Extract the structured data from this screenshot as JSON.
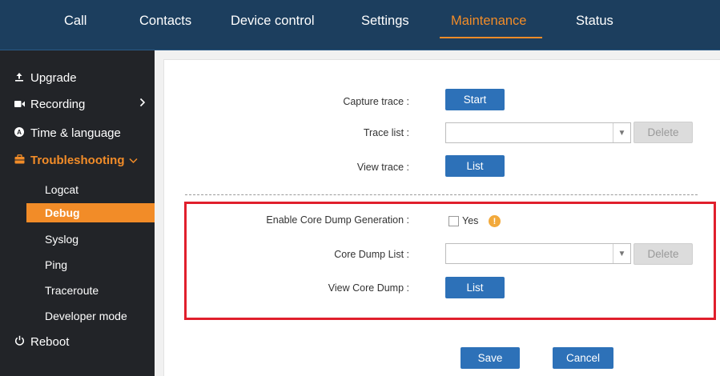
{
  "nav": {
    "tabs": [
      {
        "label": "Call"
      },
      {
        "label": "Contacts"
      },
      {
        "label": "Device control"
      },
      {
        "label": "Settings"
      },
      {
        "label": "Maintenance",
        "active": true
      },
      {
        "label": "Status"
      }
    ]
  },
  "sidebar": {
    "items": [
      {
        "label": "Upgrade",
        "icon": "upload-icon"
      },
      {
        "label": "Recording",
        "icon": "video-camera-icon"
      },
      {
        "label": "Time & language",
        "icon": "language-icon"
      },
      {
        "label": "Troubleshooting",
        "icon": "toolbox-icon"
      },
      {
        "label": "Reboot",
        "icon": "power-icon"
      }
    ],
    "sub_items": [
      "Logcat",
      "Debug",
      "Syslog",
      "Ping",
      "Traceroute",
      "Developer mode"
    ],
    "active_sub": "Debug"
  },
  "form": {
    "capture_trace_label": "Capture trace :",
    "start_button": "Start",
    "trace_list_label": "Trace list :",
    "trace_list_value": "",
    "delete_button": "Delete",
    "view_trace_label": "View trace :",
    "list_button": "List",
    "core_dump_enable_label": "Enable Core Dump Generation :",
    "core_dump_yes": "Yes",
    "core_dump_list_label": "Core Dump List :",
    "core_dump_list_value": "",
    "core_dump_delete_button": "Delete",
    "view_core_dump_label": "View Core Dump :",
    "core_dump_list_button": "List",
    "save_button": "Save",
    "cancel_button": "Cancel",
    "warning_glyph": "!"
  },
  "colors": {
    "accent": "#f28c28",
    "topbar": "#1c3e5e",
    "sidebar": "#222428",
    "button": "#2d71b8",
    "highlight_box": "#e01f2c"
  }
}
